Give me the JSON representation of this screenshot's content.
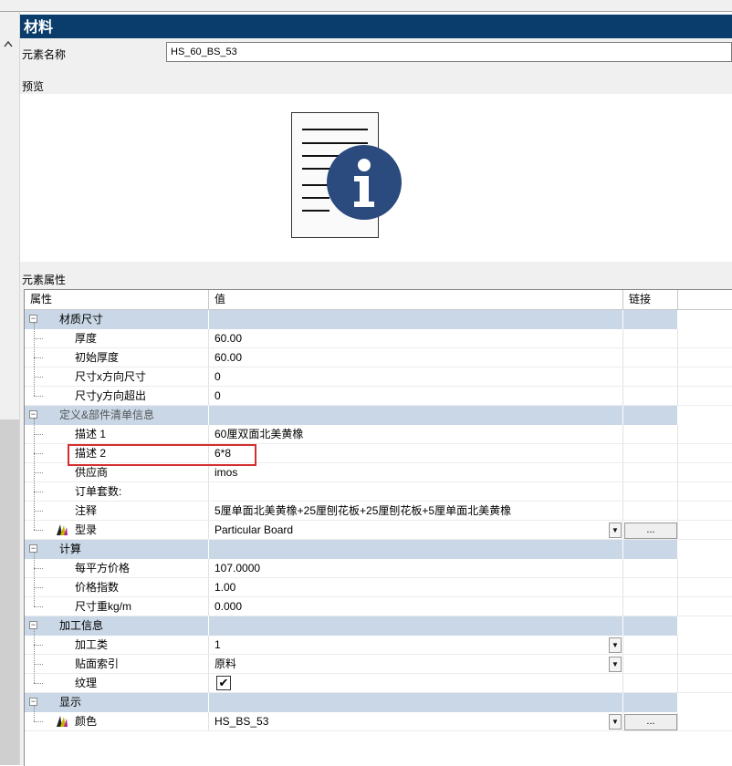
{
  "panel": {
    "title": "材料"
  },
  "name_field": {
    "label": "元素名称",
    "value": "HS_60_BS_53"
  },
  "preview": {
    "label": "预览"
  },
  "properties": {
    "label": "元素属性",
    "columns": {
      "property": "属性",
      "value": "值",
      "link": "链接"
    },
    "groups": [
      {
        "name": "材质尺寸",
        "expander": "−",
        "rows": [
          {
            "name": "厚度",
            "value": "60.00"
          },
          {
            "name": "初始厚度",
            "value": "60.00"
          },
          {
            "name": "尺寸x方向尺寸",
            "value": "0"
          },
          {
            "name": "尺寸y方向超出",
            "value": "0"
          }
        ]
      },
      {
        "name": "定义&部件清单信息",
        "expander": "−",
        "rows": [
          {
            "name": "描述 1",
            "value": "60厘双面北美黄橡"
          },
          {
            "name": "描述 2",
            "value": "6*8"
          },
          {
            "name": "供应商",
            "value": "imos"
          },
          {
            "name": "订单套数:",
            "value": ""
          },
          {
            "name": "注释",
            "value": "5厘单面北美黄橡+25厘刨花板+25厘刨花板+5厘单面北美黄橡"
          },
          {
            "name": "型录",
            "value": "Particular Board",
            "dropdown": "▼",
            "button": "..."
          }
        ]
      },
      {
        "name": "计算",
        "expander": "−",
        "rows": [
          {
            "name": "每平方价格",
            "value": "107.0000"
          },
          {
            "name": "价格指数",
            "value": "1.00"
          },
          {
            "name": "尺寸重kg/m",
            "value": "0.000"
          }
        ]
      },
      {
        "name": "加工信息",
        "expander": "−",
        "rows": [
          {
            "name": "加工类",
            "value": "1",
            "dropdown": "▼"
          },
          {
            "name": "贴面索引",
            "value": "原料",
            "dropdown": "▼"
          },
          {
            "name": "纹理",
            "value": "",
            "checkbox": "✔"
          }
        ]
      },
      {
        "name": "显示",
        "expander": "−",
        "rows": [
          {
            "name": "颜色",
            "value": "HS_BS_53",
            "dropdown": "▼",
            "button": "..."
          }
        ]
      }
    ]
  },
  "colors": {
    "titlebar": "#0a3d6b",
    "group_row": "#c9d7e6",
    "info_icon": "#2b4a7d",
    "highlight": "#d32f2f"
  },
  "icons": {
    "gutter": "chevron-up-icon",
    "preview": "document-info-icon",
    "palette": "color-palette-icon"
  }
}
